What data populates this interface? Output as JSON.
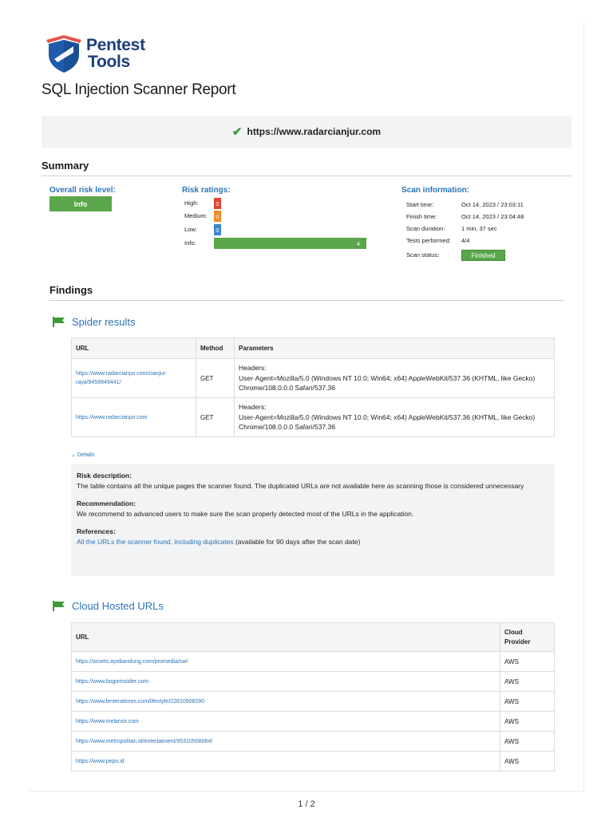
{
  "brand": {
    "line1": "Pentest",
    "line2": "Tools"
  },
  "report_title": "SQL Injection Scanner Report",
  "target": {
    "url": "https://www.radarcianjur.com",
    "status_icon": "check-icon"
  },
  "summary": {
    "title": "Summary",
    "overall_risk_label": "Overall risk level:",
    "overall_risk_value": "Info",
    "risk_ratings_label": "Risk ratings:",
    "ratings": [
      {
        "label": "High:",
        "count": "0",
        "color": "#e0462f"
      },
      {
        "label": "Medium:",
        "count": "0",
        "color": "#f08a24"
      },
      {
        "label": "Low:",
        "count": "0",
        "color": "#3a86d0"
      },
      {
        "label": "Info:",
        "count": "4",
        "color": "#5aa64a"
      }
    ],
    "scan_info_label": "Scan information:",
    "scan_info": [
      {
        "key": "Start time:",
        "value": "Oct 14, 2023 / 23:03:11"
      },
      {
        "key": "Finish time:",
        "value": "Oct 14, 2023 / 23:04:48"
      },
      {
        "key": "Scan duration:",
        "value": "1 min, 37 sec"
      },
      {
        "key": "Tests performed:",
        "value": "4/4"
      },
      {
        "key": "Scan status:",
        "value": "Finished"
      }
    ]
  },
  "findings": {
    "title": "Findings",
    "spider": {
      "title": "Spider results",
      "columns": [
        "URL",
        "Method",
        "Parameters"
      ],
      "rows": [
        {
          "url": "https://www.radarcianjur.com/cianjur-raya/9459949441/",
          "method": "GET",
          "params_head": "Headers:",
          "params": "User-Agent=Mozilla/5.0 (Windows NT 10.0; Win64; x64) AppleWebKit/537.36 (KHTML, like Gecko) Chrome/108.0.0.0 Safari/537.36"
        },
        {
          "url": "https://www.radarcianjur.com",
          "method": "GET",
          "params_head": "Headers:",
          "params": "User-Agent=Mozilla/5.0 (Windows NT 10.0; Win64; x64) AppleWebKit/537.36 (KHTML, like Gecko) Chrome/108.0.0.0 Safari/537.36"
        }
      ],
      "details_toggle": "Details",
      "risk_description_label": "Risk description:",
      "risk_description": "The table contains all the unique pages the scanner found. The duplicated URLs are not available here as scanning those is considered unnecessary",
      "recommendation_label": "Recommendation:",
      "recommendation": "We recommend to advanced users to make sure the scan properly detected most of the URLs in the application.",
      "references_label": "References:",
      "reference_link": "All the URLs the scanner found, including duplicates",
      "reference_note": "(available for 90 days after the scan date)"
    },
    "cloud": {
      "title": "Cloud Hosted URLs",
      "columns": [
        "URL",
        "Cloud Provider"
      ],
      "rows": [
        {
          "url": "https://assets.ayobandung.com/promedia/sw/",
          "provider": "AWS"
        },
        {
          "url": "https://www.bogorinsider.com",
          "provider": "AWS"
        },
        {
          "url": "https://www.lenteratimes.com/lifestyle/22810508290",
          "provider": "AWS"
        },
        {
          "url": "https://www.melansir.com",
          "provider": "AWS"
        },
        {
          "url": "https://www.metropolitan.id/entertaiment/95310508064/",
          "provider": "AWS"
        },
        {
          "url": "https://www.pepo.id",
          "provider": "AWS"
        }
      ]
    }
  },
  "footer": {
    "page": "1 / 2"
  }
}
